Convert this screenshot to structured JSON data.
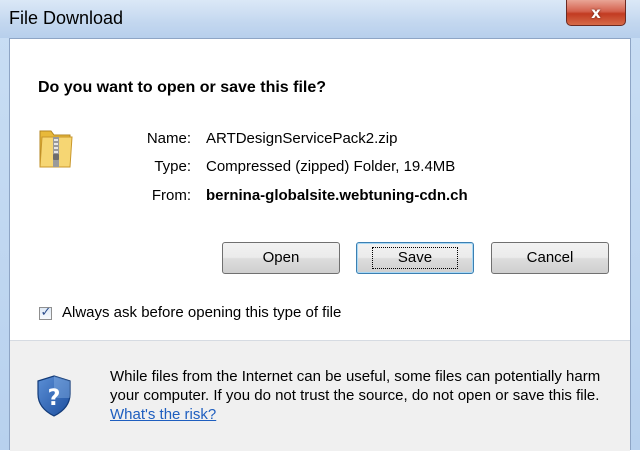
{
  "window": {
    "title": "File Download",
    "close_glyph": "x"
  },
  "dialog": {
    "heading": "Do you want to open or save this file?",
    "file": {
      "icon": "zip-folder-icon",
      "name_label": "Name:",
      "name_value": "ARTDesignServicePack2.zip",
      "type_label": "Type:",
      "type_value": "Compressed (zipped) Folder, 19.4MB",
      "from_label": "From:",
      "from_value": "bernina-globalsite.webtuning-cdn.ch"
    },
    "buttons": {
      "open": "Open",
      "save": "Save",
      "cancel": "Cancel"
    },
    "checkbox": {
      "label": "Always ask before opening this type of file",
      "checked": true
    }
  },
  "footer": {
    "icon": "shield-question-icon",
    "text": "While files from the Internet can be useful, some files can potentially harm your computer. If you do not trust the source, do not open or save this file.",
    "link": "What's the risk?"
  },
  "colors": {
    "titlebar": "#c3d7ef",
    "close_button": "#c23b22",
    "link": "#1e5ebf",
    "footer_background": "#f0f0f0"
  }
}
